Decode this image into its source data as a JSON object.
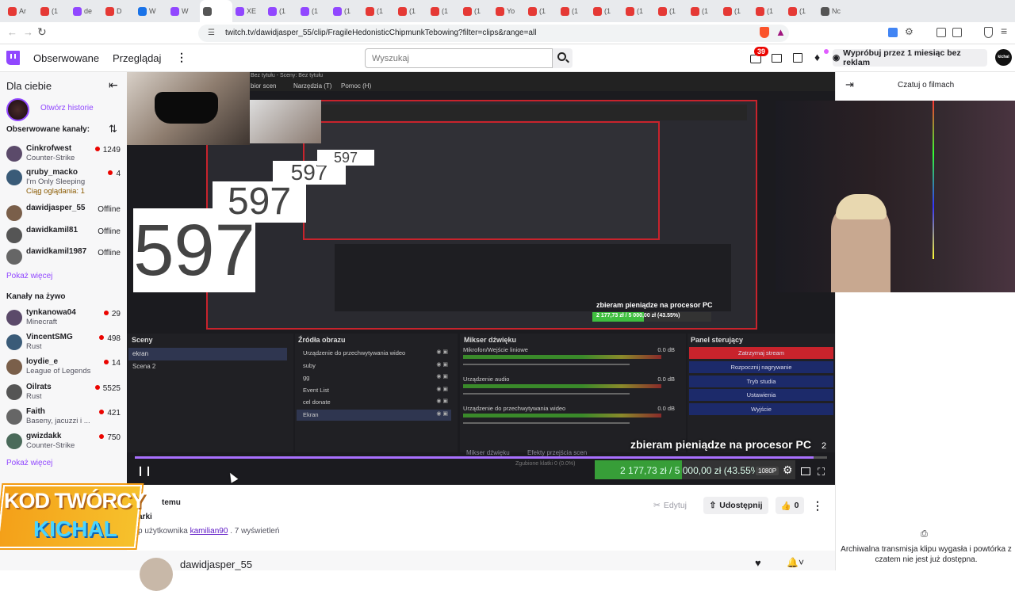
{
  "browser": {
    "tabs": [
      "Ar",
      "(1",
      "de",
      "D",
      "W",
      "W",
      "",
      "XE",
      "(1",
      "(1",
      "(1",
      "(1",
      "(1",
      "(1",
      "(1",
      "Yo",
      "(1",
      "(1",
      "(1",
      "(1",
      "(1",
      "(1",
      "(1",
      "(1",
      "(1",
      "Nc"
    ],
    "url": "twitch.tv/dawidjasper_55/clip/FragileHedonisticChipmunkTebowing?filter=clips&range=all"
  },
  "nav": {
    "following": "Obserwowane",
    "browse": "Przeglądaj",
    "search_placeholder": "Wyszukaj",
    "notif_count": "39",
    "promo": "Wypróbuj przez 1 miesiąc bez reklam",
    "avatar_text": "kichal"
  },
  "sidebar": {
    "header": "Dla ciebie",
    "stories": "Otwórz historie",
    "followed_header": "Obserwowane kanały:",
    "followed": [
      {
        "name": "Cinkrofwest",
        "game": "Counter-Strike",
        "viewers": "1249",
        "live": true
      },
      {
        "name": "qruby_macko",
        "game": "I'm Only Sleeping",
        "extra": "Ciąg oglądania: 1",
        "viewers": "4",
        "live": true
      },
      {
        "name": "dawidjasper_55",
        "viewers": "Offline",
        "live": false
      },
      {
        "name": "dawidkamil81",
        "viewers": "Offline",
        "live": false
      },
      {
        "name": "dawidkamil1987",
        "viewers": "Offline",
        "live": false
      }
    ],
    "show_more_1": "Pokaż więcej",
    "live_header": "Kanały na żywo",
    "live": [
      {
        "name": "tynkanowa04",
        "game": "Minecraft",
        "viewers": "29"
      },
      {
        "name": "VincentSMG",
        "game": "Rust",
        "viewers": "498"
      },
      {
        "name": "loydie_e",
        "game": "League of Legends",
        "viewers": "14"
      },
      {
        "name": "Oilrats",
        "game": "Rust",
        "viewers": "5525"
      },
      {
        "name": "Faith",
        "game": "Baseny, jacuzzi i ...",
        "viewers": "421"
      },
      {
        "name": "gwizdakk",
        "game": "Counter-Strike",
        "viewers": "750"
      }
    ],
    "show_more_2": "Pokaż więcej"
  },
  "video": {
    "menu_items": [
      "bior scen",
      "Narzędzia (T)",
      "Pomoc (H)"
    ],
    "title_text": "Bez tytułu - Sceny: Bez tytułu",
    "counter": "597",
    "scenes_header": "Sceny",
    "scenes": [
      "ekran",
      "Scena 2"
    ],
    "sources_header": "Źródła obrazu",
    "sources": [
      "Urządzenie do przechwytywania wideo",
      "suby",
      "gg",
      "Event List",
      "cel donate",
      "Ekran"
    ],
    "mixer_header": "Mikser dźwięku",
    "mixer": [
      {
        "label": "Mikrofon/Wejście liniowe",
        "db": "0.0 dB"
      },
      {
        "label": "Urządzenie audio",
        "db": "0.0 dB"
      },
      {
        "label": "Urządzenie do przechwytywania wideo",
        "db": "0.0 dB"
      }
    ],
    "control_header": "Panel sterujący",
    "controls": [
      "Zatrzymaj stream",
      "Rozpocznij nagrywanie",
      "Tryb studia",
      "Ustawienia",
      "Wyjście"
    ],
    "mixer_tab": "Mikser dźwięku",
    "transitions_tab": "Efekty przejścia scen",
    "frames": "Zgubione klatki 0 (0.0%)",
    "goal_text": "zbieram pieniądze na procesor PC",
    "goal_amount": "2 177,73 zł / 5 000,00 zł (43.55%)",
    "goal_fraction": 0.4355,
    "goal_badge": "2",
    "quality": "1080P",
    "progress": 0.98
  },
  "below": {
    "title_fragment": "temu",
    "subtitle_fragment": "arki",
    "clipped_by_prefix": "p użytkownika",
    "clipper": "kamilian90",
    "views": ". 7 wyświetleń",
    "edit": "Edytuj",
    "share": "Udostępnij",
    "likes": "0",
    "channel": "dawidjasper_55"
  },
  "overlay": {
    "line1": "KOD TWÓRCY",
    "line2": "KICHAL"
  },
  "chat": {
    "header": "Czatuj o filmach",
    "archive_msg": "Archiwalna transmisja klipu wygasła i powtórka z czatem nie jest już dostępna."
  },
  "colors": {
    "twitch_purple": "#9147ff",
    "live_red": "#eb0400",
    "goal_green": "#3fbf3f"
  }
}
